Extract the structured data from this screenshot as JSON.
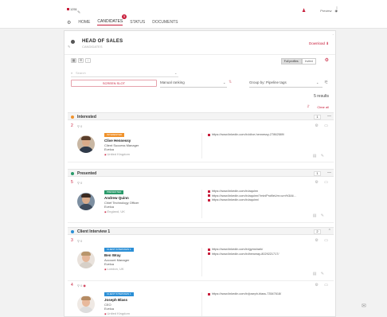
{
  "app": {
    "logo_text": "1251",
    "nav": [
      {
        "label": "HOME"
      },
      {
        "label": "CANDIDATES",
        "badge": "5"
      },
      {
        "label": "STATUS"
      },
      {
        "label": "DOCUMENTS"
      }
    ],
    "preview_label": "Preview"
  },
  "job": {
    "title": "HEAD OF SALES",
    "subtitle": "CANDIDATES",
    "download_label": "Download"
  },
  "toolbar": {
    "profile_toggle": [
      "Full profiles",
      "Invited"
    ],
    "search_placeholder": "Search",
    "bulk_label": "SCREEN SLOT",
    "ranking_label": "Manual ranking",
    "group_label": "Group by: Pipeline tags",
    "results": "5 results",
    "clear_all": "Clear all"
  },
  "stages": [
    {
      "name": "Interested",
      "color": "#f0922c",
      "count": "1",
      "candidates": [
        {
          "rank": "2",
          "tag": "INTERESTED",
          "tag_color": "#f0922c",
          "name": "Clive Hennessy",
          "role": "Client Success Manager",
          "company": "Evelca",
          "location": "United Kingdom",
          "links": [
            "https://www.linkedin.com/in/clive-hennessy-27862589/"
          ]
        }
      ]
    },
    {
      "name": "Presented",
      "color": "#2a9a6a",
      "count": "1",
      "candidates": [
        {
          "rank": "5",
          "tag": "PRESENTED",
          "tag_color": "#2a9a6a",
          "name": "Andrew Quinn",
          "role": "Chief Technology Officer",
          "company": "Evelca",
          "location": "England, UK",
          "links": [
            "https://www.linkedin.com/in/aquinn",
            "https://www.linkedin.com/in/aquinn/?miniProfileUrn=urn%3Ali...",
            "https://www.linkedin.com/in/aquinn/"
          ]
        }
      ]
    },
    {
      "name": "Client Interview 1",
      "color": "#2b8fd6",
      "count": "2",
      "candidates": [
        {
          "rank": "3",
          "tag": "CLIENT INTERVIEW 1",
          "tag_color": "#2b8fd6",
          "name": "Ben Wray",
          "role": "Account Manager",
          "company": "Evelca",
          "location": "London, UK",
          "links": [
            "https://www.linkedin.com/in/gymshark/",
            "https://www.linkedin.com/in/benwray-8029221717/"
          ]
        },
        {
          "rank": "4",
          "tag": "CLIENT INTERVIEW 1",
          "tag_color": "#2b8fd6",
          "name": "Joseph Blass",
          "role": "CEO",
          "company": "Evelca",
          "location": "United Kingdom",
          "links": [
            "https://www.linkedin.com/in/joseph-blass-73547618/"
          ]
        }
      ]
    }
  ]
}
